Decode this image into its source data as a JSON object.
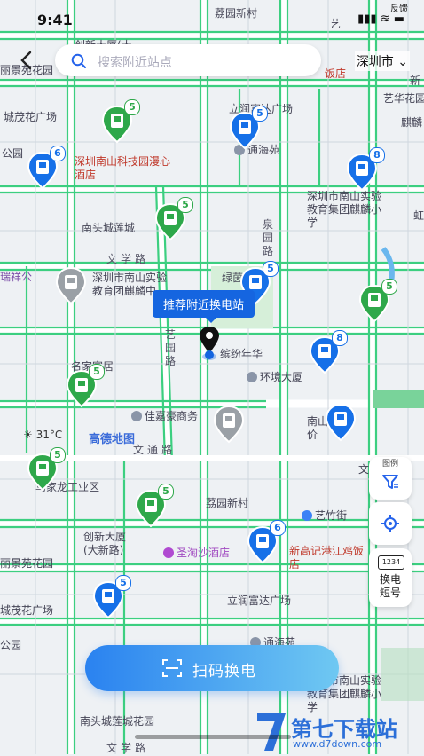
{
  "status_bar": {
    "time": "9:41",
    "feedback": "反馈",
    "icons": "▮▮▮ ≋ ▬"
  },
  "top_bar": {
    "search_placeholder": "搜索附近站点",
    "city": "深圳市",
    "back_icon": "chevron-left-icon"
  },
  "tooltip": {
    "text": "推荐附近换电站"
  },
  "map_labels": [
    {
      "id": "lz",
      "text": "荔园新村"
    },
    {
      "id": "cx1",
      "text": "创新大厦(大"
    },
    {
      "id": "ydxc",
      "text": "艺"
    },
    {
      "id": "xh",
      "text": "新"
    },
    {
      "id": "ljyg",
      "text": "丽景苑花园"
    },
    {
      "id": "fd",
      "text": "饭店"
    },
    {
      "id": "lr1",
      "text": "立润富达广场"
    },
    {
      "id": "ys",
      "text": "艺华花园"
    },
    {
      "id": "cz1",
      "text": "城茂花广场"
    },
    {
      "id": "qy",
      "text": "麒麟"
    },
    {
      "id": "thy",
      "text": "通海苑"
    },
    {
      "id": "hotel",
      "text": "深圳南山科技园漫心酒店"
    },
    {
      "id": "gy",
      "text": "公园"
    },
    {
      "id": "school1",
      "text": "深圳市南山实验教育集团麒麟小学"
    },
    {
      "id": "nt",
      "text": "南头城莲城"
    },
    {
      "id": "jjl",
      "text": "泉园路"
    },
    {
      "id": "hy",
      "text": "虹"
    },
    {
      "id": "wxl",
      "text": "文学路"
    },
    {
      "id": "lyh",
      "text": "绿茵丰"
    },
    {
      "id": "rx",
      "text": "瑞祥公"
    },
    {
      "id": "school2",
      "text": "深圳市南山实验教育团麒麟中"
    },
    {
      "id": "yyl",
      "text": "艺园路"
    },
    {
      "id": "ynh",
      "text": "缤纷年华"
    },
    {
      "id": "mjf",
      "text": "名家富居"
    },
    {
      "id": "hjdx",
      "text": "环境大厦"
    },
    {
      "id": "jhhs",
      "text": "佳嘉豪商务"
    },
    {
      "id": "wtl",
      "text": "文通路"
    },
    {
      "id": "nw",
      "text": "南山物价"
    },
    {
      "id": "ttw",
      "text": "文"
    },
    {
      "id": "xlgy",
      "text": "鸟家龙工业区"
    },
    {
      "id": "lz2",
      "text": "荔园新村"
    },
    {
      "id": "yd2",
      "text": "艺竹街"
    },
    {
      "id": "cx2",
      "text": "创新大厦(大新路)"
    },
    {
      "id": "sts",
      "text": "圣淘沙酒店"
    },
    {
      "id": "xgj",
      "text": "新高记港江鸡饭店"
    },
    {
      "id": "ljyg2",
      "text": "丽景苑花园"
    },
    {
      "id": "lr2",
      "text": "立润富达广场"
    },
    {
      "id": "cz2",
      "text": "城茂花广场"
    },
    {
      "id": "thy2",
      "text": "通海苑"
    },
    {
      "id": "school3",
      "text": "深圳市南山实验教育集团麒麟小学"
    },
    {
      "id": "nt2",
      "text": "南头城莲城花园"
    },
    {
      "id": "gy2",
      "text": "公园"
    },
    {
      "id": "wxl2",
      "text": "文学路"
    }
  ],
  "amap_logo": "高德地图",
  "weather": "31°C",
  "pins": [
    {
      "id": "p1",
      "count": "5",
      "color": "#2ea84a"
    },
    {
      "id": "p2",
      "count": "6",
      "color": "#1670e8"
    },
    {
      "id": "p3",
      "count": "5",
      "color": "#1670e8"
    },
    {
      "id": "p4",
      "count": "8",
      "color": "#1670e8"
    },
    {
      "id": "p5",
      "count": "5",
      "color": "#2ea84a"
    },
    {
      "id": "p6",
      "count": "",
      "color": "#9aa0a6"
    },
    {
      "id": "p7",
      "count": "5",
      "color": "#1670e8"
    },
    {
      "id": "p8",
      "count": "5",
      "color": "#2ea84a"
    },
    {
      "id": "p9",
      "count": "8",
      "color": "#1670e8"
    },
    {
      "id": "p10",
      "count": "5",
      "color": "#2ea84a"
    },
    {
      "id": "p11",
      "count": "",
      "color": "#1670e8"
    },
    {
      "id": "p12",
      "count": "",
      "color": "#9aa0a6"
    },
    {
      "id": "p13",
      "count": "5",
      "color": "#2ea84a"
    },
    {
      "id": "p14",
      "count": "5",
      "color": "#2ea84a"
    },
    {
      "id": "p15",
      "count": "6",
      "color": "#1670e8"
    },
    {
      "id": "p16",
      "count": "5",
      "color": "#1670e8"
    }
  ],
  "side_tools": {
    "legend_label": "图例",
    "swap_code_label": "换电短号",
    "code_badge": "1234"
  },
  "scan_button": {
    "label": "扫码换电"
  },
  "watermark": {
    "brand": "第七下载站",
    "url": "www.d7down.com"
  }
}
